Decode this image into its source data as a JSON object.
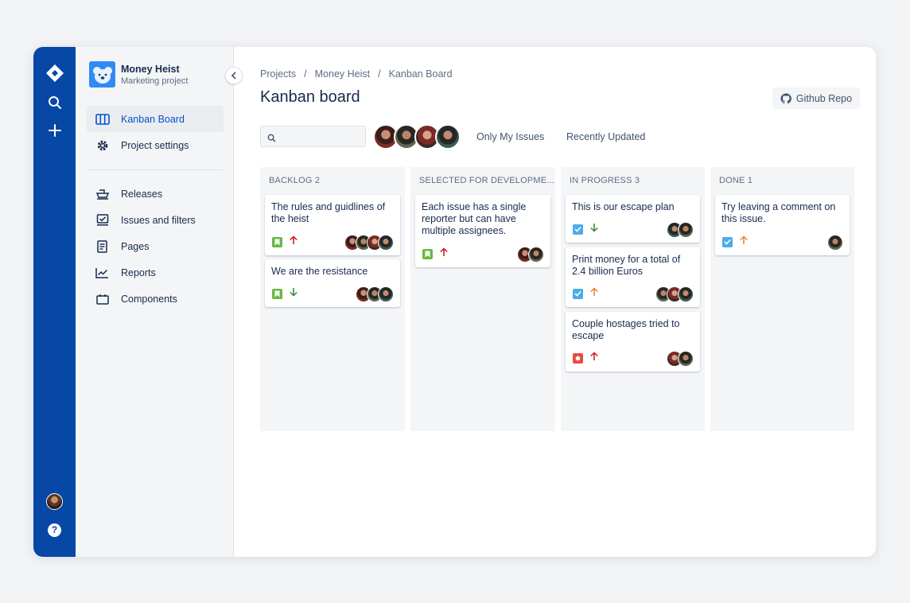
{
  "project": {
    "name": "Money Heist",
    "type": "Marketing project"
  },
  "sidebar": {
    "items": [
      {
        "label": "Kanban Board",
        "icon": "board-icon",
        "active": true
      },
      {
        "label": "Project settings",
        "icon": "gear-icon",
        "active": false
      },
      {
        "label": "Releases",
        "icon": "ship-icon",
        "active": false
      },
      {
        "label": "Issues and filters",
        "icon": "issues-icon",
        "active": false
      },
      {
        "label": "Pages",
        "icon": "page-icon",
        "active": false
      },
      {
        "label": "Reports",
        "icon": "reports-icon",
        "active": false
      },
      {
        "label": "Components",
        "icon": "component-icon",
        "active": false
      }
    ]
  },
  "breadcrumbs": [
    "Projects",
    "Money Heist",
    "Kanban Board"
  ],
  "breadcrumb_separator": "/",
  "page_title": "Kanban board",
  "github_button": "Github Repo",
  "filters": {
    "search_placeholder": "",
    "only_my_issues": "Only My Issues",
    "recently_updated": "Recently Updated",
    "user_avatars": [
      "avatar-1",
      "avatar-2",
      "avatar-3",
      "avatar-4"
    ]
  },
  "columns": [
    {
      "title": "BACKLOG 2",
      "cards": [
        {
          "text": "The rules and guidlines of the heist",
          "type": "story",
          "priority": "high",
          "assignees": 4
        },
        {
          "text": "We are the resistance",
          "type": "story",
          "priority": "low",
          "assignees": 3
        }
      ]
    },
    {
      "title": "SELECTED FOR DEVELOPME...",
      "cards": [
        {
          "text": "Each issue has a single reporter but can have multiple assignees.",
          "type": "story",
          "priority": "high",
          "assignees": 2
        }
      ]
    },
    {
      "title": "IN PROGRESS 3",
      "cards": [
        {
          "text": "This is our escape plan",
          "type": "task",
          "priority": "low",
          "assignees": 2
        },
        {
          "text": "Print money for a total of 2.4 billion Euros",
          "type": "task",
          "priority": "medium",
          "assignees": 3
        },
        {
          "text": "Couple hostages tried to escape",
          "type": "bug",
          "priority": "high",
          "assignees": 2
        }
      ]
    },
    {
      "title": "DONE 1",
      "cards": [
        {
          "text": "Try leaving a comment on this issue.",
          "type": "task",
          "priority": "medium",
          "assignees": 1
        }
      ]
    }
  ],
  "colors": {
    "global_nav": "#0747a6",
    "story": "#65ba43",
    "task": "#4bade8",
    "bug": "#e44d42",
    "priority_high": "#cd1317",
    "priority_medium": "#e97f33",
    "priority_low": "#2d8738"
  }
}
